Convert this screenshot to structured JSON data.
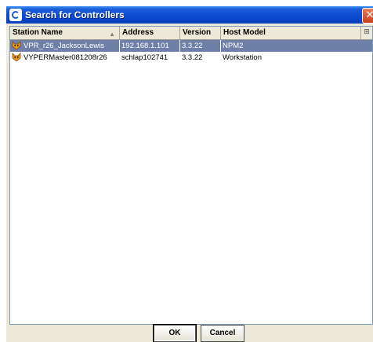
{
  "window": {
    "title": "Search for Controllers",
    "close_label": "✕"
  },
  "table": {
    "columns": [
      {
        "label": "Station Name",
        "sorted": true
      },
      {
        "label": "Address"
      },
      {
        "label": "Version"
      },
      {
        "label": "Host Model"
      }
    ],
    "column_menu_icon": "column-chooser-icon",
    "rows": [
      {
        "station_name": "VPR_r26_JacksonLewis",
        "address": "192.168.1.101",
        "version": "3.3.22",
        "host_model": "NPM2",
        "selected": true,
        "icon": "fox-icon"
      },
      {
        "station_name": "VYPERMaster081208r26",
        "address": "schlap102741",
        "version": "3.3.22",
        "host_model": "Workstation",
        "selected": false,
        "icon": "fox-icon"
      }
    ]
  },
  "buttons": {
    "ok_label": "OK",
    "cancel_label": "Cancel"
  },
  "colors": {
    "title_bar": "#0a4ad0",
    "selection": "#6f80a8",
    "dialog_bg": "#ece9d8"
  }
}
